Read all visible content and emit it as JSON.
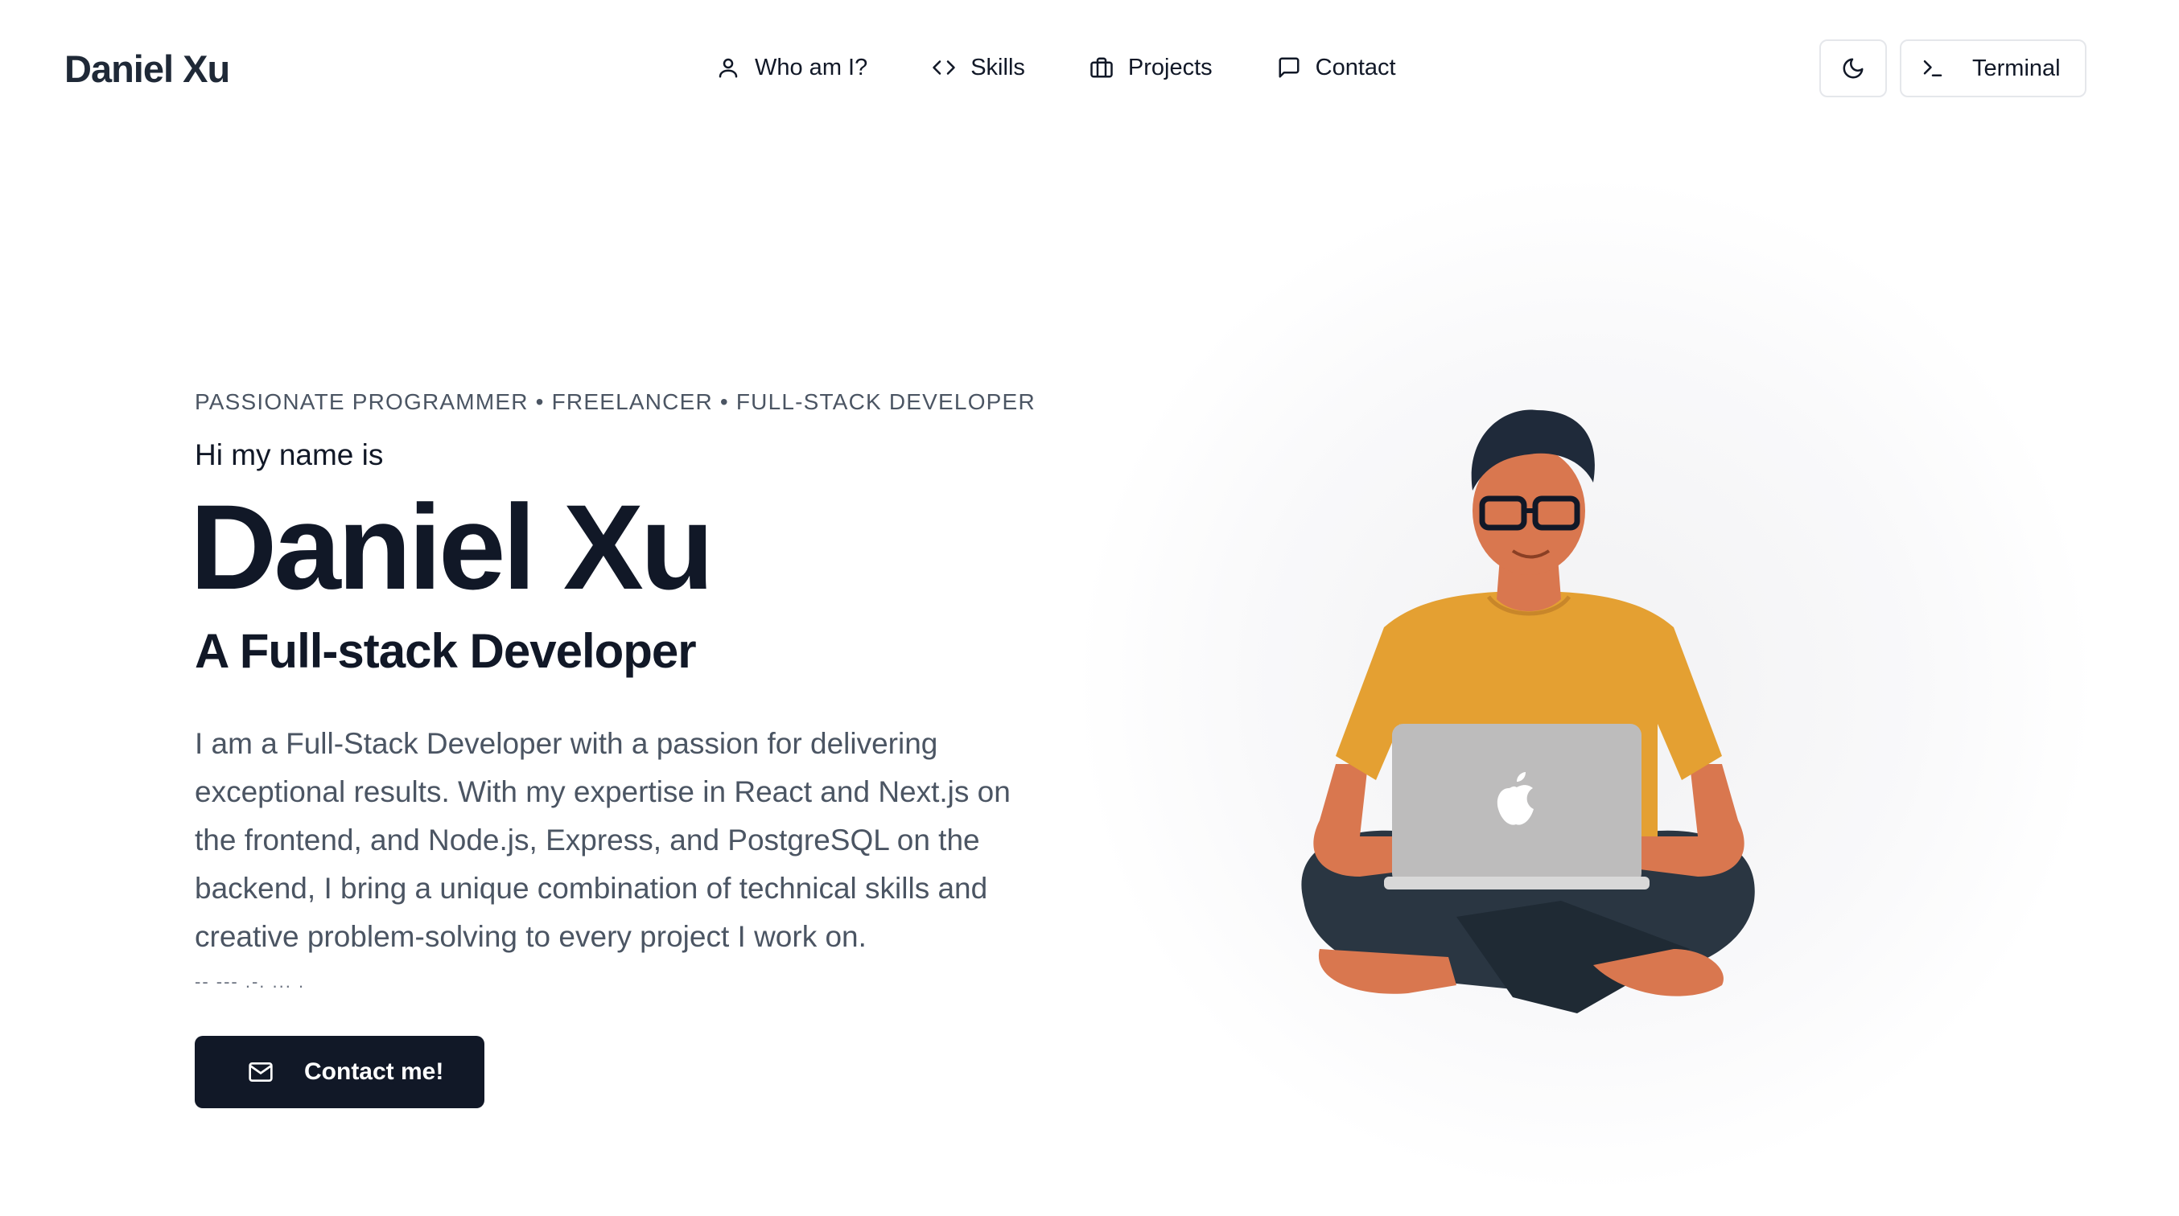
{
  "header": {
    "brand": "Daniel Xu",
    "nav": [
      {
        "label": "Who am I?",
        "icon": "user-icon"
      },
      {
        "label": "Skills",
        "icon": "code-icon"
      },
      {
        "label": "Projects",
        "icon": "briefcase-icon"
      },
      {
        "label": "Contact",
        "icon": "message-icon"
      }
    ],
    "theme_toggle_icon": "moon-icon",
    "terminal_label": "Terminal",
    "terminal_icon": "terminal-icon"
  },
  "hero": {
    "tagline": "PASSIONATE PROGRAMMER • FREELANCER • FULL-STACK DEVELOPER",
    "intro": "Hi my name is",
    "name": "Daniel Xu",
    "role": "A Full-stack Developer",
    "bio": "I am a Full-Stack Developer with a passion for delivering exceptional results. With my expertise in React and Next.js on the frontend, and Node.js, Express, and PostgreSQL on the backend, I bring a unique combination of technical skills and creative problem-solving to every project I work on.",
    "morse": "-- --- .-. ... .",
    "cta_label": "Contact me!",
    "cta_icon": "mail-icon"
  },
  "colors": {
    "text": "#111827",
    "muted": "#4b5563",
    "button_bg": "#111827",
    "shirt": "#e4a032",
    "pants": "#2a3642",
    "skin": "#d9774f",
    "laptop": "#bdbcbc"
  }
}
